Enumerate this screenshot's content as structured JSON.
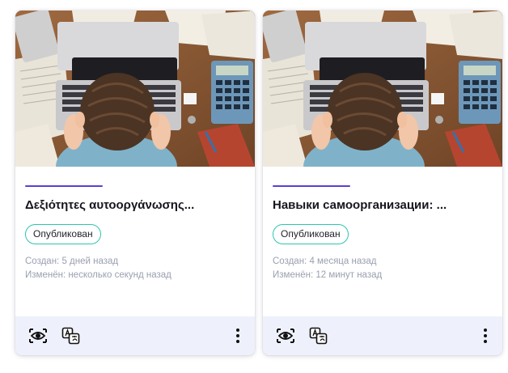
{
  "cards": [
    {
      "title": "Δεξιότητες αυτοοργάνωσης...",
      "status": "Опубликован",
      "created": "Создан: 5 дней назад",
      "modified": "Изменён: несколько секунд назад"
    },
    {
      "title": "Навыки самоорганизации: ...",
      "status": "Опубликован",
      "created": "Создан: 4 месяца назад",
      "modified": "Изменён: 12 минут назад"
    }
  ],
  "icons": {
    "view": "eye-icon",
    "translate": "translate-icon",
    "more": "more-vertical-icon"
  },
  "colors": {
    "accent": "#5b3fd6",
    "status_border": "#2ec5b1",
    "footer_bg": "#eef1fb"
  }
}
